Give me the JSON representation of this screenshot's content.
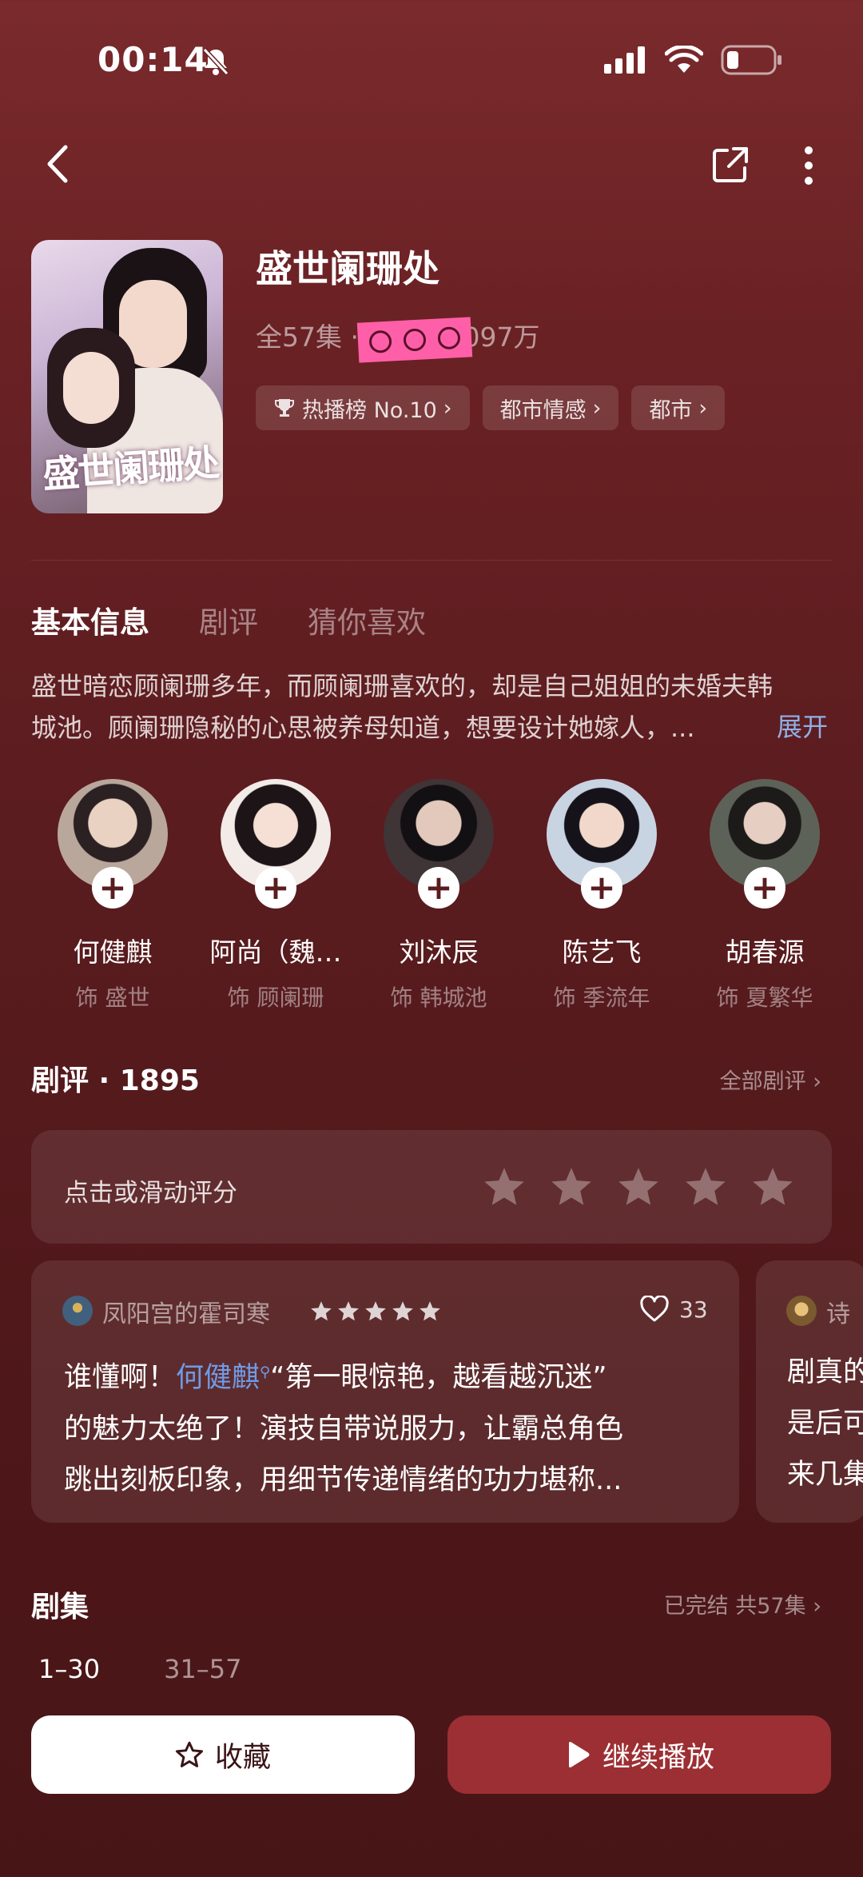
{
  "status_bar": {
    "time": "00:14"
  },
  "drama": {
    "title": "盛世阑珊处",
    "meta": "全57集 · 热度值6097万",
    "poster_title": "盛世阑珊处",
    "tags": [
      {
        "label": "热播榜 No.10",
        "icon": "trophy-icon"
      },
      {
        "label": "都市情感"
      },
      {
        "label": "都市"
      }
    ]
  },
  "tabs": [
    {
      "label": "基本信息",
      "active": true
    },
    {
      "label": "剧评",
      "active": false
    },
    {
      "label": "猜你喜欢",
      "active": false
    }
  ],
  "synopsis": {
    "line1": "盛世暗恋顾阑珊多年，而顾阑珊喜欢的，却是自己姐姐的未婚夫韩",
    "line2": "城池。顾阑珊隐秘的心思被养母知道，想要设计她嫁人，...",
    "expand": "展开"
  },
  "cast": [
    {
      "name": "何健麒",
      "role": "饰 盛世",
      "color": "#b9a79b"
    },
    {
      "name": "阿尚（魏…",
      "role": "饰 顾阑珊",
      "color": "#f3ebe8"
    },
    {
      "name": "刘沐辰",
      "role": "饰 韩城池",
      "color": "#3f3436"
    },
    {
      "name": "陈艺飞",
      "role": "饰 季流年",
      "color": "#c9d4e2"
    },
    {
      "name": "胡春源",
      "role": "饰 夏繁华",
      "color": "#5d6258"
    }
  ],
  "reviews": {
    "title": "剧评 · 1895",
    "all_link": "全部剧评",
    "rate_prompt": "点击或滑动评分",
    "items": [
      {
        "user": "凤阳宫的霍司寒",
        "likes": "33",
        "mention": "何健麒",
        "text_after_mention": "“第一眼惊艳，越看越沉迷”",
        "text_prefix": "谁懂啊！",
        "line2": "的魅力太绝了！演技自带说服力，让霸总角色",
        "line3": "跳出刻板印象，用细节传递情绪的功力堪称..."
      },
      {
        "user": "诗",
        "line1": "剧真的",
        "line2": "是后可",
        "line3": "来几集"
      }
    ]
  },
  "episodes": {
    "title": "剧集",
    "status": "已完结 共57集",
    "ranges": [
      {
        "label": "1–30",
        "active": true
      },
      {
        "label": "31–57",
        "active": false
      }
    ]
  },
  "actions": {
    "favorite": "收藏",
    "play": "继续播放"
  }
}
